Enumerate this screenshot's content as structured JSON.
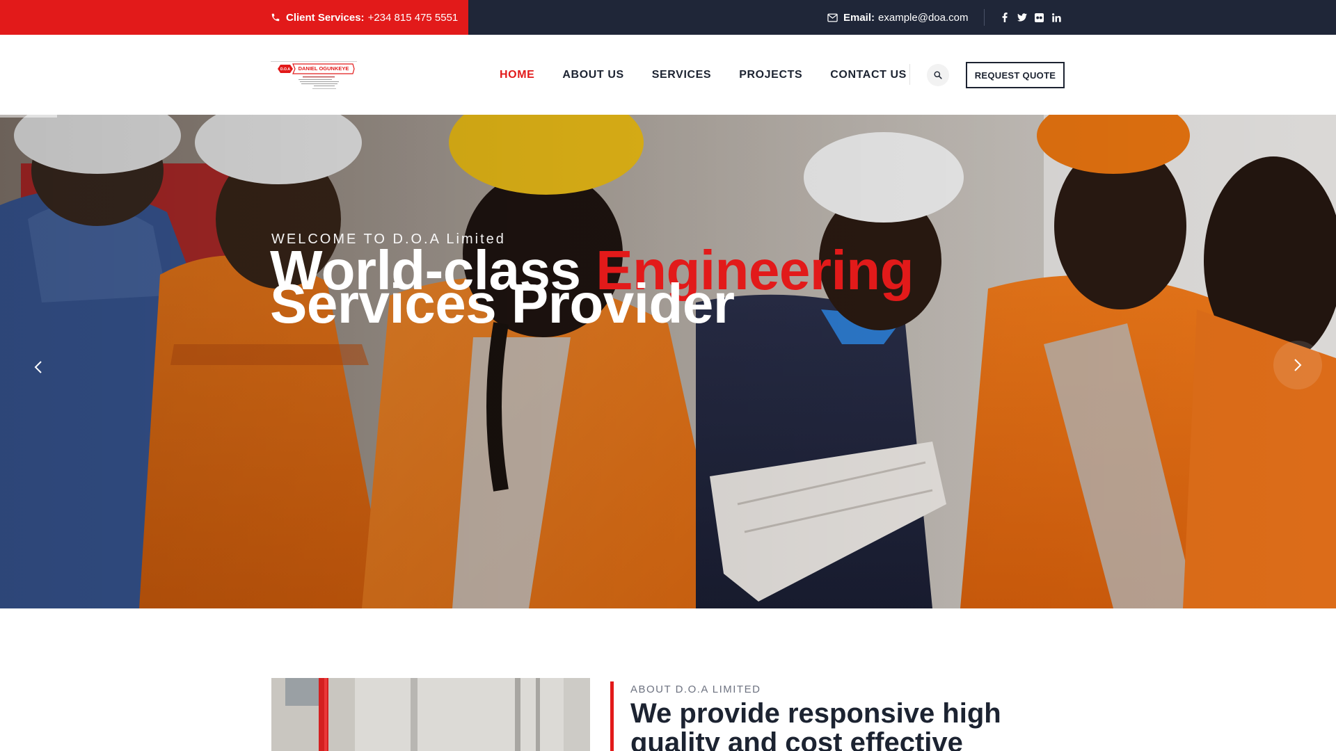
{
  "topbar": {
    "phone_label": "Client Services:",
    "phone_value": "+234 815 475 5551",
    "email_label": "Email:",
    "email_value": "example@doa.com",
    "social": [
      {
        "icon": "facebook-icon",
        "glyph": "f"
      },
      {
        "icon": "twitter-icon",
        "glyph": "t"
      },
      {
        "icon": "flickr-icon",
        "glyph": "●●"
      },
      {
        "icon": "linkedin-icon",
        "glyph": "in"
      }
    ],
    "colors": {
      "red": "#e21a1a",
      "dark": "#1f2638"
    }
  },
  "header": {
    "logo_text": "D.O.A DANIEL OGUNKEYE",
    "nav": [
      {
        "label": "HOME",
        "active": true
      },
      {
        "label": "ABOUT US",
        "active": false
      },
      {
        "label": "SERVICES",
        "active": false
      },
      {
        "label": "PROJECTS",
        "active": false
      },
      {
        "label": "CONTACT US",
        "active": false
      }
    ],
    "quote_button": "REQUEST QUOTE"
  },
  "hero": {
    "kicker": "WELCOME TO D.O.A Limited",
    "title_part1": "World-class ",
    "title_accent": "Engineering",
    "title_line2": "Services Provider"
  },
  "about": {
    "kicker": "ABOUT D.O.A LIMITED",
    "title": "We provide responsive high quality and cost effective"
  }
}
